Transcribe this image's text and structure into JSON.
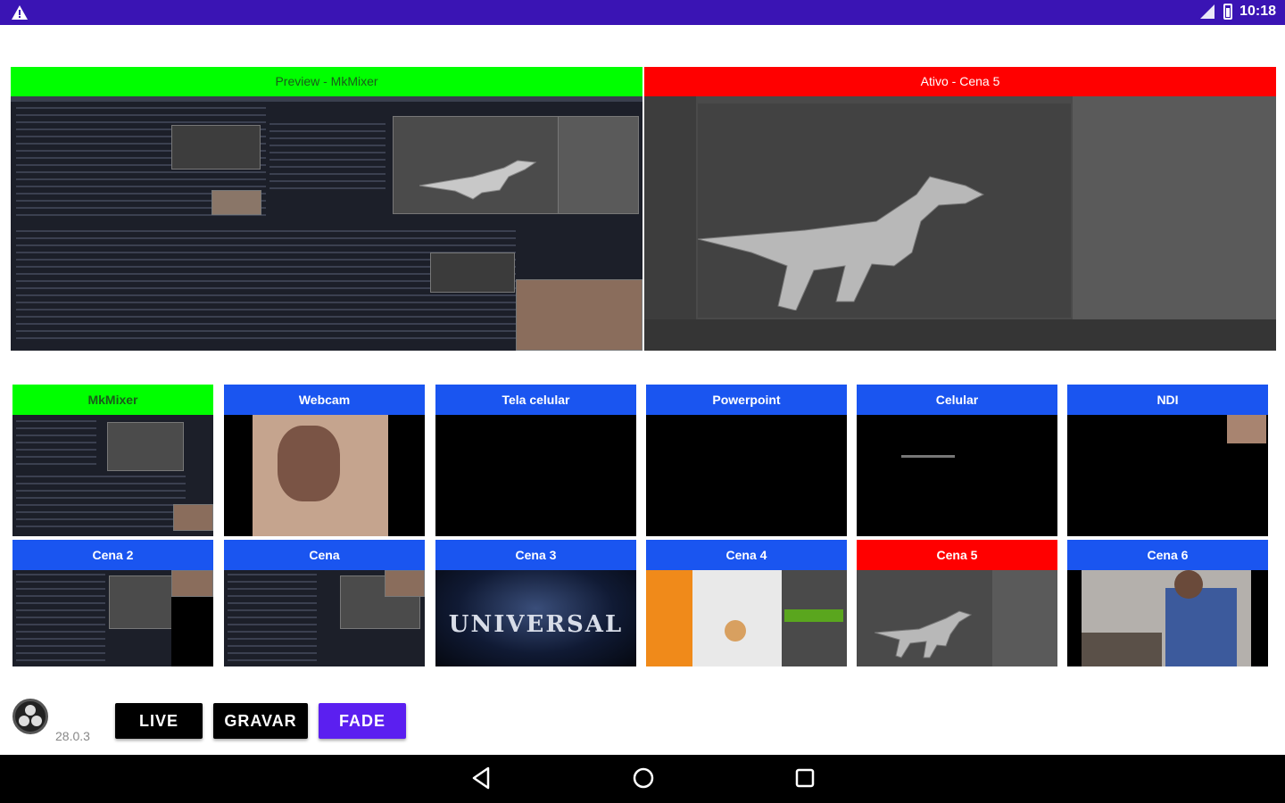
{
  "status_bar": {
    "time": "10:18"
  },
  "preview": {
    "label": "Preview - MkMixer"
  },
  "program": {
    "label": "Ativo - Cena 5"
  },
  "scenes_row1": [
    {
      "label": "MkMixer",
      "state": "preview",
      "content": "desktop"
    },
    {
      "label": "Webcam",
      "state": "idle",
      "content": "webcam"
    },
    {
      "label": "Tela celular",
      "state": "idle",
      "content": "black"
    },
    {
      "label": "Powerpoint",
      "state": "idle",
      "content": "black"
    },
    {
      "label": "Celular",
      "state": "idle",
      "content": "black-text"
    },
    {
      "label": "NDI",
      "state": "idle",
      "content": "ndi"
    }
  ],
  "scenes_row2": [
    {
      "label": "Cena 2",
      "state": "idle",
      "content": "desktop"
    },
    {
      "label": "Cena",
      "state": "idle",
      "content": "desktop"
    },
    {
      "label": "Cena 3",
      "state": "idle",
      "content": "universal"
    },
    {
      "label": "Cena 4",
      "state": "idle",
      "content": "blender-orange"
    },
    {
      "label": "Cena 5",
      "state": "active",
      "content": "blender"
    },
    {
      "label": "Cena 6",
      "state": "idle",
      "content": "person"
    }
  ],
  "universal_text": "UNIVERSAL",
  "controls": {
    "live_label": "LIVE",
    "record_label": "GRAVAR",
    "fade_label": "FADE"
  },
  "version": "28.0.3",
  "colors": {
    "preview": "#00ff00",
    "active": "#ff0000",
    "idle": "#1a55f0",
    "fade": "#5b1ff0",
    "statusbar": "#3a14b4"
  }
}
